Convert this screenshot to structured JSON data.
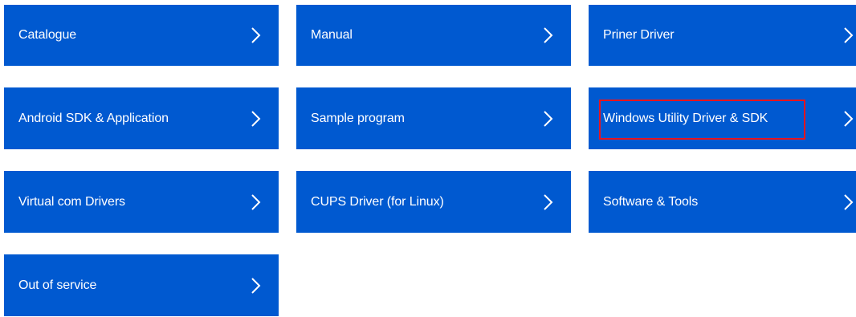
{
  "tiles": [
    {
      "label": "Catalogue"
    },
    {
      "label": "Manual"
    },
    {
      "label": "Priner Driver"
    },
    {
      "label": "Android SDK & Application"
    },
    {
      "label": "Sample program"
    },
    {
      "label": "Windows Utility Driver & SDK"
    },
    {
      "label": "Virtual com Drivers"
    },
    {
      "label": "CUPS Driver (for Linux)"
    },
    {
      "label": "Software & Tools"
    },
    {
      "label": "Out of service"
    }
  ],
  "icons": {
    "chevron": "chevron-right-icon"
  },
  "colors": {
    "tile_background": "#0059d0",
    "tile_text": "#ffffff",
    "highlight_border": "#e8141e"
  }
}
